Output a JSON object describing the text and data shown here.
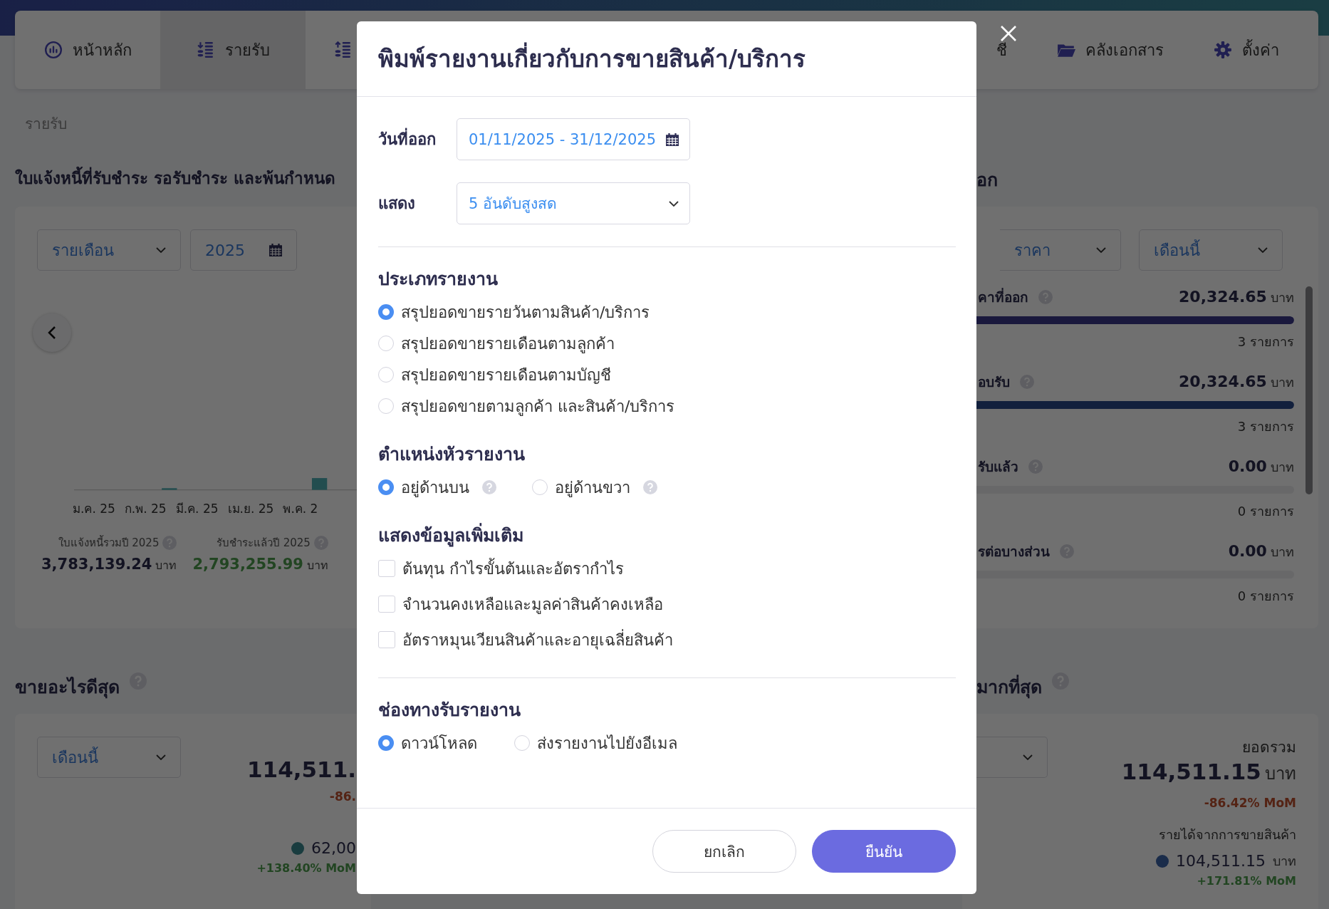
{
  "nav": {
    "left_items": [
      {
        "kind": "home",
        "label": "หน้าหลัก",
        "selected": false
      },
      {
        "kind": "income",
        "label": "รายรับ",
        "selected": true
      },
      {
        "kind": "expense",
        "selected": false
      }
    ],
    "right_items": [
      {
        "kind": "text",
        "label": "ชี"
      },
      {
        "kind": "folder",
        "label": "คลังเอกสาร"
      },
      {
        "kind": "gear",
        "label": "ตั้งค่า"
      }
    ]
  },
  "breadcrumb": "รายรับ",
  "invoices": {
    "title": "ใบแจ้งหนี้ที่รับชำระ รอรับชำระ และพ้นกำหนด",
    "period": "รายเดือน",
    "year": "2025",
    "month_labels": [
      "ม.ค. 25",
      "ก.พ. 25",
      "มี.ค. 25",
      "เม.ย. 25",
      "พ.ค. 2"
    ],
    "stats": [
      {
        "kind": "total",
        "label": "ใบแจ้งหนี้รวมปี 2025",
        "value": "3,783,139.24",
        "unit": "บาท"
      },
      {
        "kind": "paid",
        "label": "รับชำระแล้วปี 2025",
        "value": "2,793,255.99",
        "unit": "บาท"
      }
    ]
  },
  "quotes": {
    "title": "อก",
    "type_filter": "ราคา",
    "period": "เดือนนี้",
    "rows": [
      {
        "label": "คาที่ออก",
        "amount": "20,324.65",
        "unit": "บาท",
        "level": 1,
        "count": "3 รายการ"
      },
      {
        "label": "อบรับ",
        "amount": "20,324.65",
        "unit": "บาท",
        "level": 1,
        "count": "3 รายการ"
      },
      {
        "label": "รับแล้ว",
        "amount": "0.00",
        "unit": "บาท",
        "level": 0,
        "count": "0 รายการ"
      },
      {
        "label": "รต่อบางส่วน",
        "amount": "0.00",
        "unit": "บาท",
        "level": 0,
        "count": "0 รายการ"
      }
    ]
  },
  "best_sellers": {
    "title": "ขายอะไรดีสุด",
    "period": "เดือนนี้",
    "total": "114,511.",
    "change": "-86.",
    "item_value": "62,00",
    "item_change": "+138.40% MoM"
  },
  "top_customers": {
    "title": "มากที่สุด",
    "total_label": "ยอดรวม",
    "total": "114,511.15",
    "unit": "บาท",
    "change": "-86.42% MoM",
    "item_label": "รายได้จากการขายสินค้า",
    "item_value": "104,511.15",
    "item_unit": "บาท",
    "item_change": "+171.81% MoM"
  },
  "dialog": {
    "title": "พิมพ์รายงานเกี่ยวกับการขายสินค้า/บริการ",
    "date_label": "วันที่ออก",
    "date_value": "01/11/2025 - 31/12/2025",
    "show_label": "แสดง",
    "show_value": "5 อันดับสูงสด",
    "report_type": {
      "heading": "ประเภทรายงาน",
      "options": [
        {
          "label": "สรุปยอดขายรายวันตามสินค้า/บริการ",
          "selected": true
        },
        {
          "label": "สรุปยอดขายรายเดือนตามลูกค้า",
          "selected": false
        },
        {
          "label": "สรุปยอดขายรายเดือนตามบัญชี",
          "selected": false
        },
        {
          "label": "สรุปยอดขายตามลูกค้า และสินค้า/บริการ",
          "selected": false
        }
      ]
    },
    "header_position": {
      "heading": "ตำแหน่งหัวรายงาน",
      "options": [
        {
          "label": "อยู่ด้านบน",
          "selected": true,
          "help": true
        },
        {
          "label": "อยู่ด้านขวา",
          "selected": false,
          "help": true
        }
      ]
    },
    "extra": {
      "heading": "แสดงข้อมูลเพิ่มเติม",
      "options": [
        {
          "label": "ต้นทุน กำไรขั้นต้นและอัตรากำไร",
          "checked": false
        },
        {
          "label": "จำนวนคงเหลือและมูลค่าสินค้าคงเหลือ",
          "checked": false
        },
        {
          "label": "อัตราหมุนเวียนสินค้าและอายุเฉลี่ยสินค้า",
          "checked": false
        }
      ]
    },
    "channel": {
      "heading": "ช่องทางรับรายงาน",
      "options": [
        {
          "label": "ดาวน์โหลด",
          "selected": true
        },
        {
          "label": "ส่งรายงานไปยังอีเมล",
          "selected": false
        }
      ]
    },
    "buttons": [
      {
        "kind": "secondary",
        "label": "ยกเลิก"
      },
      {
        "kind": "primary",
        "label": "ยืนยัน"
      }
    ]
  }
}
